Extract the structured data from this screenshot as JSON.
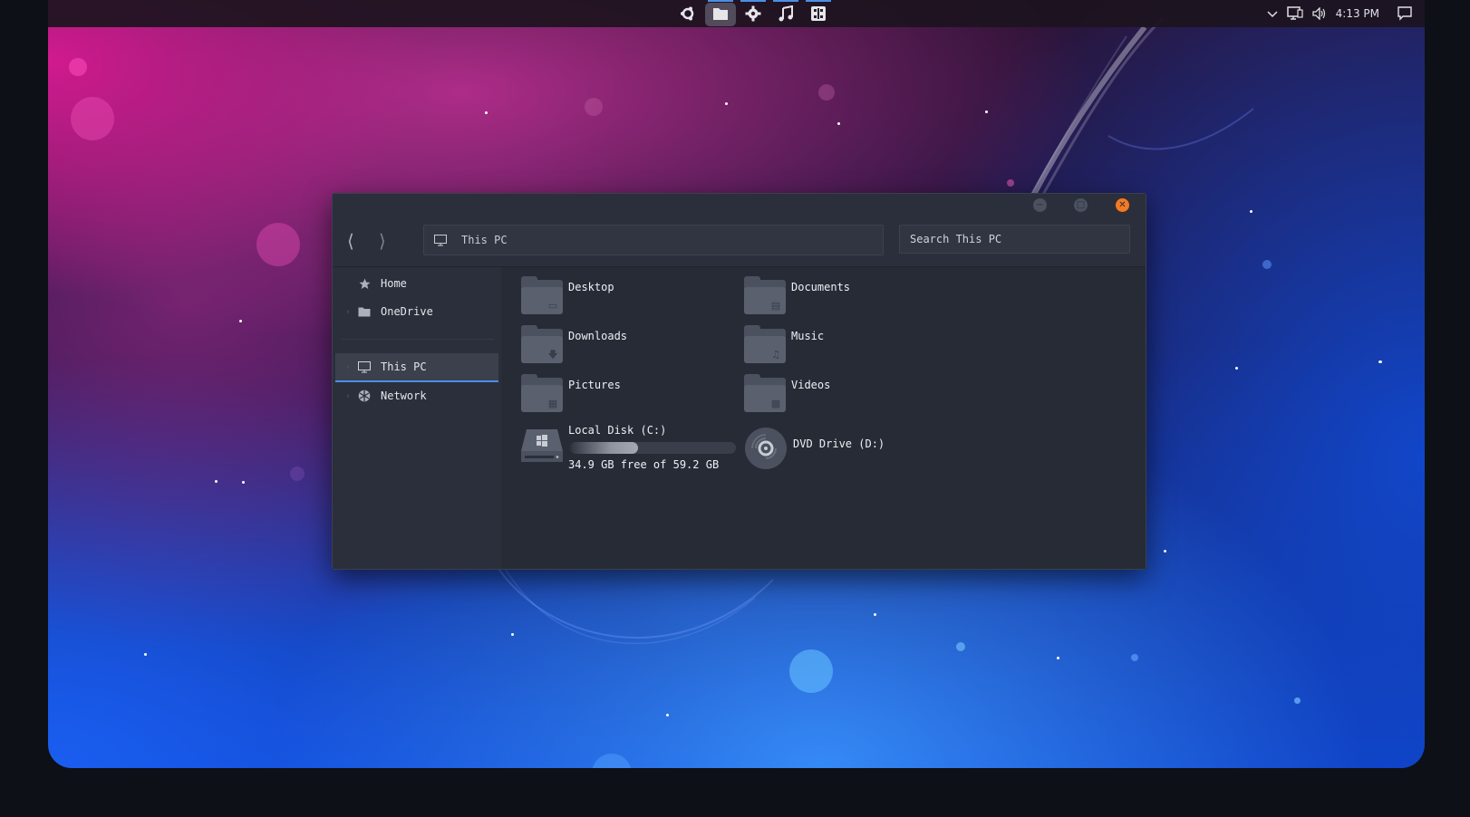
{
  "taskbar": {
    "dock": [
      {
        "name": "launcher",
        "icon": "launcher-icon"
      },
      {
        "name": "files",
        "icon": "folder-icon",
        "active": true
      },
      {
        "name": "settings",
        "icon": "gear-icon"
      },
      {
        "name": "music",
        "icon": "music-note-icon"
      },
      {
        "name": "calculator",
        "icon": "calculator-icon"
      }
    ],
    "tray": {
      "clock": "4:13 PM",
      "icons": [
        "chevron-down-icon",
        "network-icon",
        "volume-icon",
        "notification-icon"
      ]
    }
  },
  "window": {
    "controls": [
      "minimize-icon",
      "maximize-icon",
      "close-icon"
    ],
    "address": {
      "icon": "computer-icon",
      "path": "This PC"
    },
    "search": {
      "placeholder": "Search This PC"
    },
    "sidebar": {
      "items": [
        {
          "label": "Home",
          "icon": "star-icon",
          "expandable": false
        },
        {
          "label": "OneDrive",
          "icon": "folder-icon",
          "expandable": true
        },
        {
          "label": "This PC",
          "icon": "computer-icon",
          "expandable": true,
          "selected": true
        },
        {
          "label": "Network",
          "icon": "network-globe-icon",
          "expandable": true
        }
      ]
    },
    "content": {
      "folders": [
        {
          "label": "Desktop",
          "icon": "desktop-folder-icon"
        },
        {
          "label": "Documents",
          "icon": "documents-folder-icon"
        },
        {
          "label": "Downloads",
          "icon": "downloads-folder-icon"
        },
        {
          "label": "Music",
          "icon": "music-folder-icon"
        },
        {
          "label": "Pictures",
          "icon": "pictures-folder-icon"
        },
        {
          "label": "Videos",
          "icon": "videos-folder-icon"
        }
      ],
      "drives": [
        {
          "label": "Local Disk (C:)",
          "icon": "hard-drive-icon",
          "free_text": "34.9 GB free of 59.2 GB",
          "used_fraction": 0.41
        },
        {
          "label": "DVD Drive (D:)",
          "icon": "dvd-drive-icon"
        }
      ]
    }
  },
  "colors": {
    "accent": "#4a8fe6",
    "close_button": "#f47a22",
    "window_bg": "#272b36"
  }
}
